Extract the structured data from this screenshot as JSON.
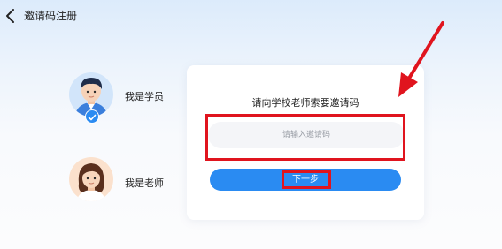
{
  "header": {
    "title": "邀请码注册",
    "back_icon": "chevron-left-icon"
  },
  "roles": [
    {
      "label": "我是学员",
      "selected": true,
      "avatar_icon": "boy-avatar-icon"
    },
    {
      "label": "我是老师",
      "selected": false,
      "avatar_icon": "girl-avatar-icon"
    }
  ],
  "card": {
    "prompt": "请向学校老师索要邀请码",
    "input_placeholder": "请输入邀请码",
    "input_value": "",
    "next_label": "下一步"
  },
  "colors": {
    "accent": "#2a8bf2",
    "highlight": "#e0141e",
    "student_avatar_bg": "#d2e5fa",
    "teacher_avatar_bg": "#fbe1cd"
  }
}
